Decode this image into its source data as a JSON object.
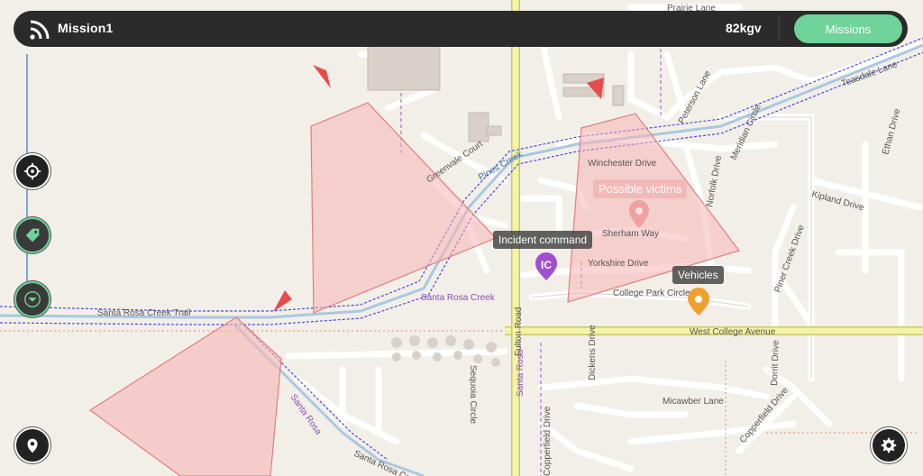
{
  "topbar": {
    "mission_name": "Mission1",
    "metric": "82kgv",
    "missions_label": "Missions"
  },
  "map": {
    "street_labels": {
      "prairie_lane": "Prairie Lane",
      "peterson_lane": "Peterson Lane",
      "teasdale_lane": "Teasdale Lane",
      "meridian_circle": "Meridian Circle",
      "ethan_drive": "Ethan Drive",
      "winchester_drive": "Winchester Drive",
      "norfolk_drive": "Norfolk Drive",
      "kipland_drive": "Kipland Drive",
      "piner_creek_drive": "Piner Creek Drive",
      "yorkshire_drive": "Yorkshire Drive",
      "sherham_way": "Sherham Way",
      "college_park_circle": "College Park Circle",
      "west_college_avenue": "West College Avenue",
      "fulton_road": "Fulton Road",
      "santa_rosa_creek_trail": "Santa Rosa Creek Trail",
      "santa_rosa_creek": "Santa Rosa Creek",
      "santa_rosa": "Santa Rosa",
      "pines_creek": "Pines Creek",
      "greenvale_court": "Greenvale Court",
      "sequoia_circle": "Sequoia Circle",
      "dickens_drive": "Dickens Drive",
      "micawber_lane": "Micawber Lane",
      "copperfield_drive": "Copperfield Drive",
      "dorrit_drive": "Dorrit Drive",
      "santa_rosa_creek_bottom": "Santa Rosa Creek"
    },
    "labels": {
      "incident_command": "Incident command",
      "possible_victims": "Possible victims",
      "vehicles": "Vehicles"
    },
    "ic_text": "IC"
  },
  "colors": {
    "topbar": "#2b2b2b",
    "accent": "#6fd39a",
    "zone_fill": "#f5b5b5",
    "zone_stroke": "#e07f7f",
    "marker_red": "#e74c4c",
    "ic_purple": "#a14fcf",
    "vehicle_orange": "#f0a030",
    "water_blue": "#aac8e0",
    "road_yellow": "#f4f3a6"
  },
  "icons": {
    "feed": "rss-feed-icon",
    "locate": "crosshair-icon",
    "tag": "tag-icon",
    "filter": "dropdown-icon",
    "pin": "pin-icon",
    "settings": "gear-icon"
  }
}
